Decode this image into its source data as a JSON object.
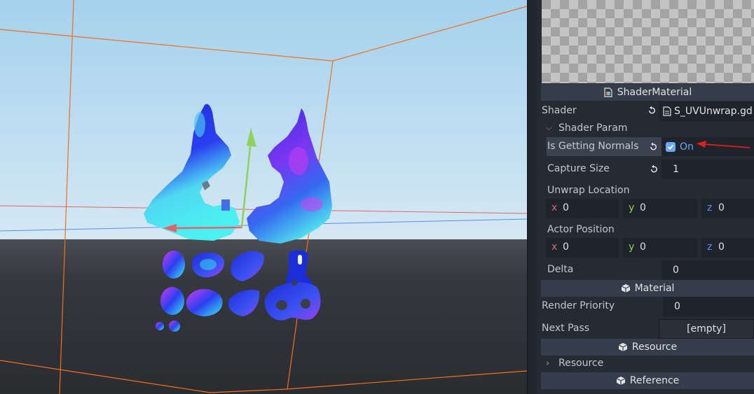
{
  "viewport": {
    "name": "3d-viewport"
  },
  "inspector": {
    "material_header": "ShaderMaterial",
    "shader": {
      "label": "Shader",
      "value": "S_UVUnwrap.gd"
    },
    "shader_param": {
      "label": "Shader Param",
      "expanded": true
    },
    "is_getting_normals": {
      "label": "Is Getting Normals",
      "value": "On",
      "checked": true
    },
    "capture_size": {
      "label": "Capture Size",
      "value": "1"
    },
    "unwrap_location": {
      "label": "Unwrap Location",
      "x": "0",
      "y": "0",
      "z": "0"
    },
    "actor_position": {
      "label": "Actor Position",
      "x": "0",
      "y": "0",
      "z": "0"
    },
    "delta": {
      "label": "Delta",
      "value": "0"
    },
    "material_section": "Material",
    "render_priority": {
      "label": "Render Priority",
      "value": "0"
    },
    "next_pass": {
      "label": "Next Pass",
      "value": "[empty]"
    },
    "resource_section": "Resource",
    "resource_fold": {
      "label": "Resource",
      "expanded": false
    },
    "reference_section": "Reference",
    "axis_labels": {
      "x": "x",
      "y": "y",
      "z": "z"
    }
  },
  "colors": {
    "accent_blue": "#6ea7f2",
    "axis_x": "#e0666b",
    "axis_y": "#8fd15a",
    "axis_z": "#5c8de6",
    "annotation_arrow": "#e01f1f",
    "bounds_orange": "#f07020"
  }
}
